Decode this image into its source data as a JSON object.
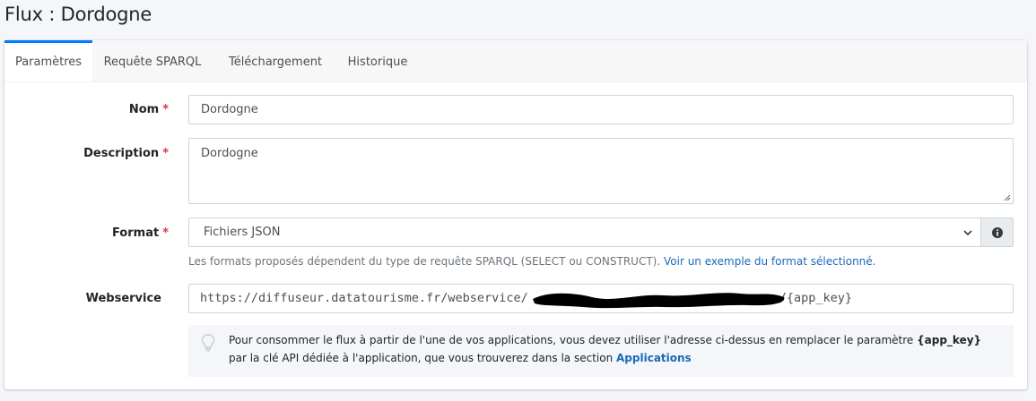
{
  "page": {
    "title": "Flux : Dordogne"
  },
  "tabs": [
    {
      "label": "Paramètres",
      "active": true
    },
    {
      "label": "Requête SPARQL",
      "active": false
    },
    {
      "label": "Téléchargement",
      "active": false
    },
    {
      "label": "Historique",
      "active": false
    }
  ],
  "form": {
    "nom": {
      "label": "Nom",
      "required_mark": "*",
      "value": "Dordogne"
    },
    "description": {
      "label": "Description",
      "required_mark": "*",
      "value": "Dordogne"
    },
    "format": {
      "label": "Format",
      "required_mark": "*",
      "selected": "Fichiers JSON",
      "help_text": "Les formats proposés dépendent du type de requête SPARQL (SELECT ou CONSTRUCT).",
      "help_link": "Voir un exemple du format sélectionné."
    },
    "webservice": {
      "label": "Webservice",
      "url_prefix": "https://diffuseur.datatourisme.fr/webservice/",
      "url_suffix": "/{app_key}",
      "callout_part1": "Pour consommer le flux à partir de l'une de vos applications, vous devez utiliser l'adresse ci-dessus en remplacer le paramètre",
      "callout_param": "{app_key}",
      "callout_part2": "par la clé API dédiée à l'application, que vous trouverez dans la section",
      "callout_link": "Applications"
    }
  },
  "icons": {
    "select": "chevron-down-icon",
    "info": "info-circle-icon",
    "callout": "lightbulb-icon"
  },
  "colors": {
    "accent": "#007bff",
    "required": "#dc3545",
    "link": "#1a6ab5"
  }
}
